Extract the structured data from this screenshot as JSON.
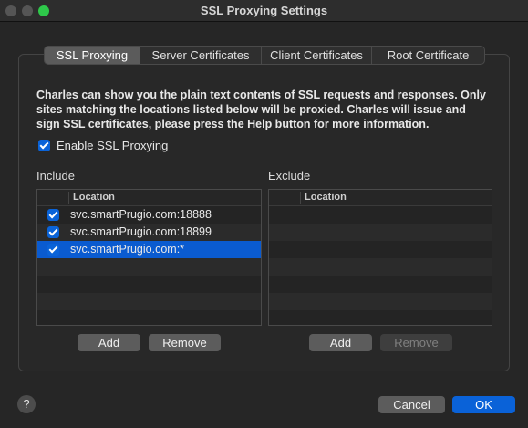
{
  "window": {
    "title": "SSL Proxying Settings"
  },
  "tabs": [
    {
      "label": "SSL Proxying",
      "active": true
    },
    {
      "label": "Server Certificates",
      "active": false
    },
    {
      "label": "Client Certificates",
      "active": false
    },
    {
      "label": "Root Certificate",
      "active": false
    }
  ],
  "description": "Charles can show you the plain text contents of SSL requests and responses. Only sites matching the locations listed below will be proxied. Charles will issue and sign SSL certificates, please press the Help button for more information.",
  "enable_ssl": {
    "label": "Enable SSL Proxying",
    "checked": true
  },
  "include": {
    "label": "Include",
    "column_header": "Location",
    "rows": [
      {
        "location": "svc.smartPrugio.com:18888",
        "checked": true,
        "selected": false
      },
      {
        "location": "svc.smartPrugio.com:18899",
        "checked": true,
        "selected": false
      },
      {
        "location": "svc.smartPrugio.com:*",
        "checked": true,
        "selected": true
      }
    ],
    "add_label": "Add",
    "remove_label": "Remove"
  },
  "exclude": {
    "label": "Exclude",
    "column_header": "Location",
    "rows": [],
    "add_label": "Add",
    "remove_label": "Remove"
  },
  "footer": {
    "help_label": "?",
    "cancel_label": "Cancel",
    "ok_label": "OK"
  },
  "colors": {
    "accent": "#0a62d8",
    "selection": "#0a5bd0"
  }
}
